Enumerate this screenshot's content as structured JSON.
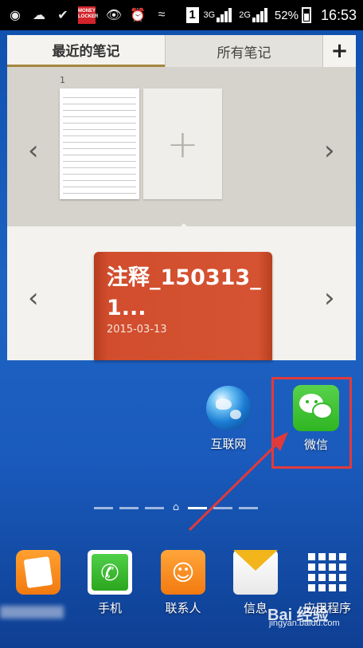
{
  "status_bar": {
    "app_badge": "MONEY LOCKER",
    "network_sim1": "3G",
    "network_sim2": "2G",
    "sim_indicator": "1",
    "battery": "52%",
    "time": "16:53"
  },
  "widget": {
    "tabs": [
      {
        "label": "最近的笔记",
        "selected": true
      },
      {
        "label": "所有笔记",
        "selected": false
      }
    ],
    "add_tab_label": "+",
    "page_number": "1",
    "add_page_label": "+",
    "notebook": {
      "title": "注释_150313_1...",
      "date": "2015-03-13"
    }
  },
  "apps": {
    "internet": "互联网",
    "wechat": "微信"
  },
  "dock": {
    "phone": "手机",
    "contacts": "联系人",
    "messages": "信息",
    "apps": "应用程序"
  },
  "watermark": {
    "logo": "Bai 经验",
    "url": "jingyan.baidu.com"
  },
  "colors": {
    "highlight": "#e23a3a",
    "notebook": "#d55332",
    "tab_accent": "#a5863f"
  }
}
